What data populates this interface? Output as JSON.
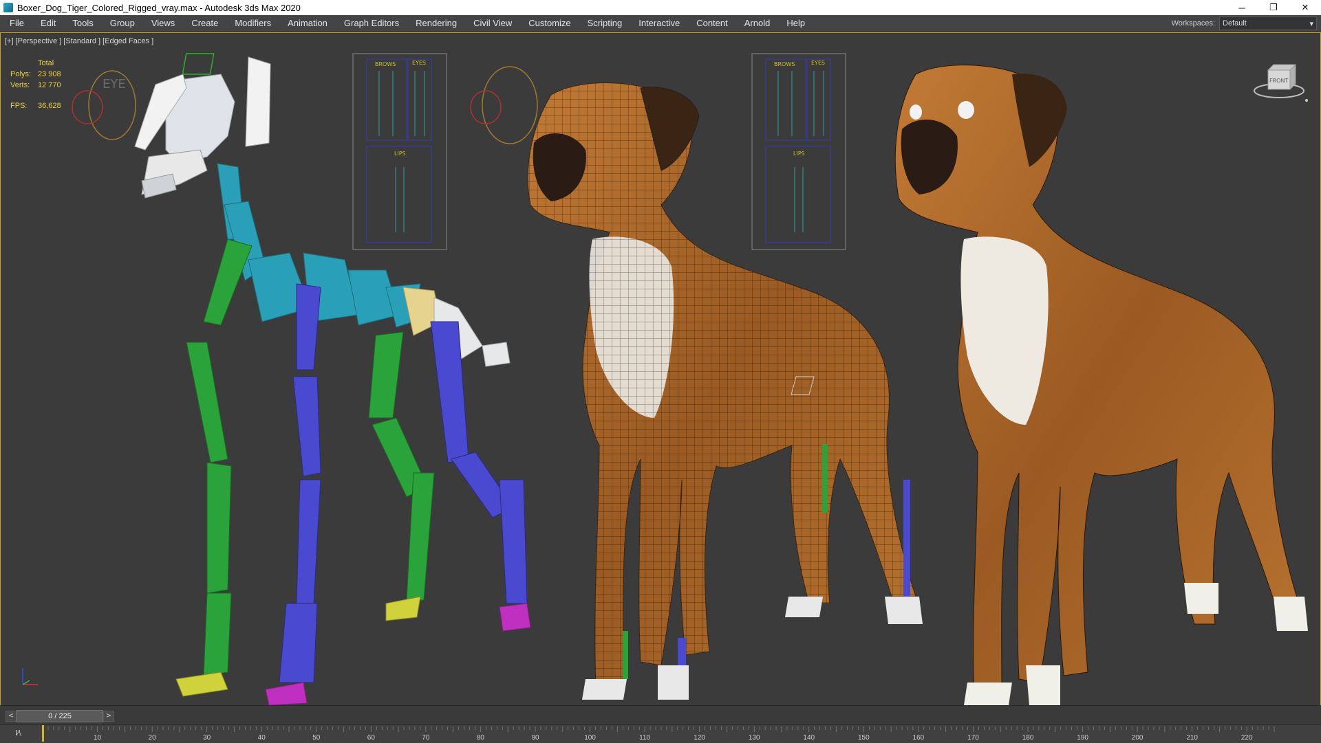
{
  "window": {
    "title": "Boxer_Dog_Tiger_Colored_Rigged_vray.max - Autodesk 3ds Max 2020",
    "controls": [
      "─",
      "❐",
      "✕"
    ]
  },
  "menu": {
    "items": [
      "File",
      "Edit",
      "Tools",
      "Group",
      "Views",
      "Create",
      "Modifiers",
      "Animation",
      "Graph Editors",
      "Rendering",
      "Civil View",
      "Customize",
      "Scripting",
      "Interactive",
      "Content",
      "Arnold",
      "Help"
    ],
    "workspaces_label": "Workspaces:",
    "workspace_value": "Default"
  },
  "viewport": {
    "label": "[+] [Perspective ] [Standard ] [Edged Faces ]",
    "stats": {
      "header": "Total",
      "polys_label": "Polys:",
      "polys_value": "23 908",
      "verts_label": "Verts:",
      "verts_value": "12 770",
      "fps_label": "FPS:",
      "fps_value": "36,628"
    },
    "rig_panels": {
      "brows": "BROWS",
      "eyes": "EYES",
      "lips": "LIPS",
      "eye_target": "EYE"
    },
    "viewcube_label": "FRONT"
  },
  "timeslider": {
    "prev": "<",
    "frame_display": "0 / 225",
    "next": ">"
  },
  "trackbar": {
    "icon_label": "I⁄\\",
    "ticks": [
      "10",
      "20",
      "30",
      "40",
      "50",
      "60",
      "70",
      "80",
      "90",
      "100",
      "110",
      "120",
      "130",
      "140",
      "150",
      "160",
      "170",
      "180",
      "190",
      "200",
      "210",
      "220"
    ]
  },
  "colors": {
    "viewport_border": "#c9a227",
    "stats_text": "#f0d040",
    "rig_green": "#2aa33a",
    "rig_blue": "#4a4ad0",
    "rig_cyan": "#2aa0b8",
    "rig_white": "#e6e8ea",
    "dog_fur": "#b56a2a"
  }
}
